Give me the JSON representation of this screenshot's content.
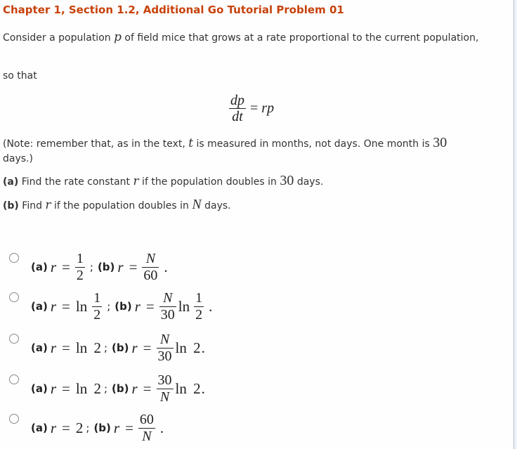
{
  "title": "Chapter 1, Section 1.2, Additional Go Tutorial Problem 01",
  "intro": {
    "line1_pre": "Consider a population ",
    "var_p": "p",
    "line1_post": " of field mice that grows at a rate proportional to the current population,",
    "so_that": "so that"
  },
  "equation": {
    "numerator": "dp",
    "denominator": "dt",
    "equals": "=",
    "rhs_r": "r",
    "rhs_p": "p"
  },
  "note": {
    "pre": "(Note: remember that, as in the text, ",
    "var_t": "t",
    "mid": " is measured in months, not days. One month is ",
    "num": "30",
    "post": " days.)"
  },
  "part_a": {
    "label": "(a)",
    "pre": " Find the rate constant ",
    "var": "r",
    "mid": " if the population doubles in ",
    "num": "30",
    "post": " days."
  },
  "part_b": {
    "label": "(b)",
    "pre": " Find ",
    "var": "r",
    "mid": " if the population doubles in ",
    "num": "N",
    "post": " days."
  },
  "common": {
    "a_label": "(a)",
    "b_label": "(b)",
    "r": "r",
    "eq": "=",
    "semi": ";",
    "period": ".",
    "ln": "ln"
  },
  "options": [
    {
      "a": {
        "num": "1",
        "den": "2"
      },
      "b": {
        "num": "N",
        "den": "60"
      },
      "selected": false
    },
    {
      "a": {
        "prefix": "ln",
        "num": "1",
        "den": "2"
      },
      "b": {
        "num": "N",
        "den": "30",
        "suffix": "ln",
        "suffix_num": "1",
        "suffix_den": "2"
      },
      "selected": false
    },
    {
      "a": {
        "value": "ln 2"
      },
      "b": {
        "num": "N",
        "den": "30",
        "suffix": "ln 2"
      },
      "selected": false
    },
    {
      "a": {
        "value": "ln 2"
      },
      "b": {
        "num": "30",
        "den": "N",
        "suffix": "ln 2"
      },
      "selected": false
    },
    {
      "a": {
        "value": "2"
      },
      "b": {
        "num": "60",
        "den": "N"
      },
      "selected": false
    }
  ],
  "colors": {
    "title": "#c8420c",
    "text": "#333333",
    "radio_border": "#8a8a8a"
  }
}
